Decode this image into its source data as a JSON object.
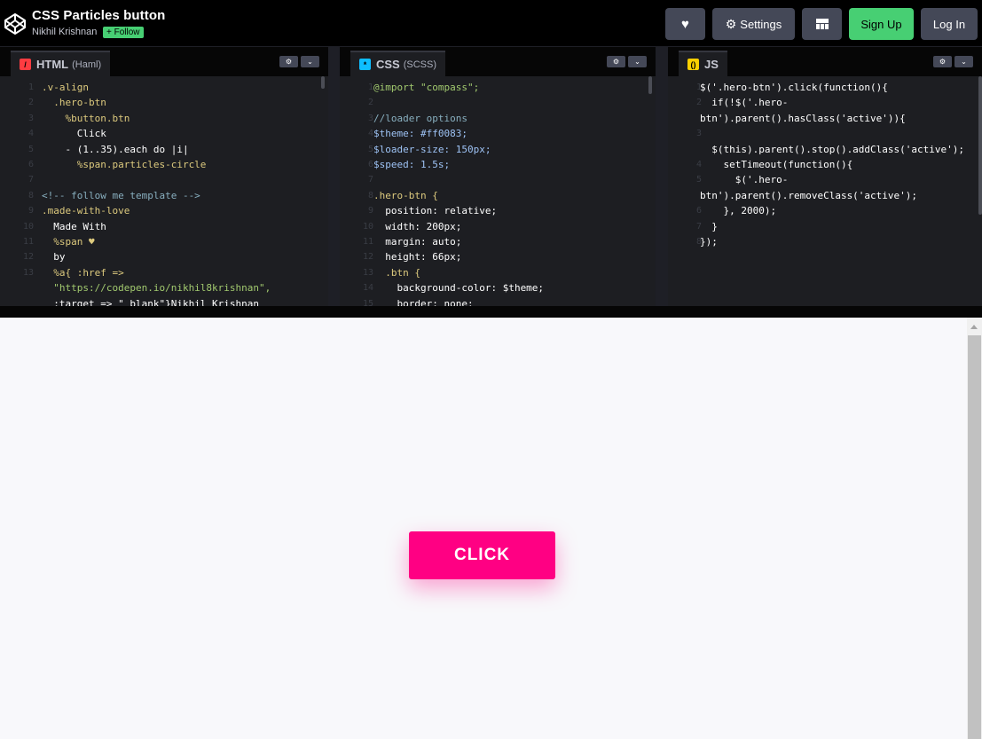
{
  "header": {
    "title": "CSS Particles button",
    "author": "Nikhil Krishnan",
    "follow": "+ Follow",
    "settings": "Settings",
    "signup": "Sign Up",
    "login": "Log In"
  },
  "panels": {
    "html": {
      "name": "HTML",
      "sub": "(Haml)"
    },
    "css": {
      "name": "CSS",
      "sub": "(SCSS)"
    },
    "js": {
      "name": "JS",
      "sub": ""
    }
  },
  "code": {
    "html": [
      {
        "n": "1",
        "t": ".v-align"
      },
      {
        "n": "2",
        "t": "  .hero-btn"
      },
      {
        "n": "3",
        "t": "    %button.btn"
      },
      {
        "n": "4",
        "t": "      Click"
      },
      {
        "n": "5",
        "t": "    - (1..35).each do |i|"
      },
      {
        "n": "6",
        "t": "      %span.particles-circle"
      },
      {
        "n": "7",
        "t": ""
      },
      {
        "n": "8",
        "t": "<!-- follow me template -->"
      },
      {
        "n": "9",
        "t": ".made-with-love"
      },
      {
        "n": "10",
        "t": "  Made With"
      },
      {
        "n": "11",
        "t": "  %span ♥"
      },
      {
        "n": "12",
        "t": "  by"
      },
      {
        "n": "13",
        "t": "  %a{ :href =>"
      },
      {
        "n": "",
        "t": "  \"https://codepen.io/nikhil8krishnan\","
      },
      {
        "n": "",
        "t": "  :target => \"_blank\"}Nikhil Krishnan"
      }
    ],
    "css": [
      {
        "n": "1",
        "t": "@import \"compass\";"
      },
      {
        "n": "2",
        "t": ""
      },
      {
        "n": "3",
        "t": "//loader options"
      },
      {
        "n": "4",
        "t": "$theme: #ff0083;"
      },
      {
        "n": "5",
        "t": "$loader-size: 150px;"
      },
      {
        "n": "6",
        "t": "$speed: 1.5s;"
      },
      {
        "n": "7",
        "t": ""
      },
      {
        "n": "8",
        "t": ".hero-btn {"
      },
      {
        "n": "9",
        "t": "  position: relative;"
      },
      {
        "n": "10",
        "t": "  width: 200px;"
      },
      {
        "n": "11",
        "t": "  margin: auto;"
      },
      {
        "n": "12",
        "t": "  height: 66px;"
      },
      {
        "n": "13",
        "t": "  .btn {"
      },
      {
        "n": "14",
        "t": "    background-color: $theme;"
      },
      {
        "n": "15",
        "t": "    border: none;"
      }
    ],
    "js": [
      {
        "n": "1",
        "t": "$('.hero-btn').click(function(){"
      },
      {
        "n": "2",
        "t": "  if(!$('.hero-"
      },
      {
        "n": "",
        "t": "btn').parent().hasClass('active')){"
      },
      {
        "n": "3",
        "t": ""
      },
      {
        "n": "",
        "t": "  $(this).parent().stop().addClass('active');"
      },
      {
        "n": "4",
        "t": "    setTimeout(function(){"
      },
      {
        "n": "5",
        "t": "      $('.hero-"
      },
      {
        "n": "",
        "t": "btn').parent().removeClass('active');"
      },
      {
        "n": "6",
        "t": "    }, 2000);"
      },
      {
        "n": "7",
        "t": "  }"
      },
      {
        "n": "8",
        "t": "});"
      }
    ]
  },
  "preview": {
    "button_label": "CLICK"
  },
  "colors": {
    "accent": "#ff0083",
    "signup": "#47cf73"
  }
}
